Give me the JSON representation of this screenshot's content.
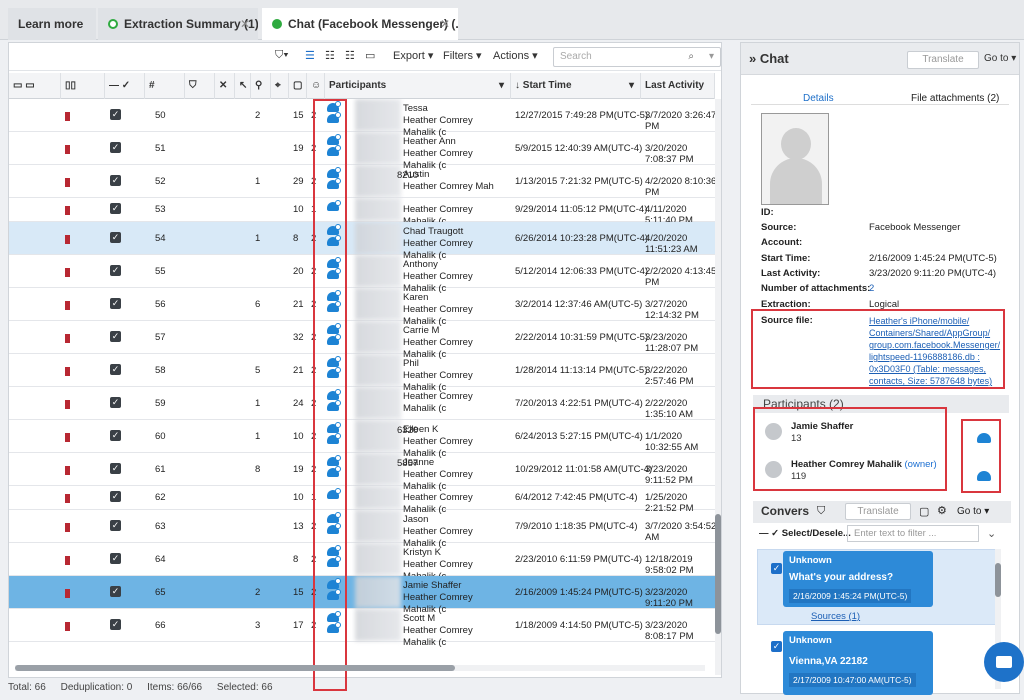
{
  "tabs": [
    {
      "label": "Learn more",
      "active": false,
      "has_dot": false,
      "closable": false
    },
    {
      "label": "Extraction Summary (1)",
      "active": false,
      "has_dot": true,
      "dot_color": "#2eaa3f",
      "closable": true
    },
    {
      "label": "Chat (Facebook Messenger) (...",
      "active": true,
      "has_dot": true,
      "dot_color": "#2eaa3f",
      "closable": true
    }
  ],
  "toolbar": {
    "export": "Export",
    "filters": "Filters",
    "actions": "Actions",
    "search_placeholder": "Search"
  },
  "columns": {
    "num": "#",
    "participants": "Participants",
    "start": "Start Time",
    "last": "Last Activity"
  },
  "rows": [
    {
      "num": "50",
      "att": "2",
      "c1": "15",
      "c2": "2",
      "p1": "Tessa ",
      "p2": "Heather Comrey Mahalik (c",
      "st": "12/27/2015 7:49:28 PM(UTC-5)",
      "la": "3/7/2020 3:26:47 PM",
      "pid": "",
      "sel": ""
    },
    {
      "num": "51",
      "att": "",
      "c1": "19",
      "c2": "2",
      "p1": "Heather Ann",
      "p2": "Heather Comrey Mahalik (c",
      "st": "5/9/2015 12:40:39 AM(UTC-4)",
      "la": "3/20/2020 7:08:37 PM",
      "pid": "",
      "sel": ""
    },
    {
      "num": "52",
      "att": "1",
      "c1": "29",
      "c2": "2",
      "p1": "Austin ",
      "p2": "Heather Comrey Mah",
      "st": "1/13/2015 7:21:32 PM(UTC-5)",
      "la": "4/2/2020 8:10:36 PM",
      "pid": "8210",
      "sel": ""
    },
    {
      "num": "53",
      "att": "",
      "c1": "10",
      "c2": "1",
      "p1": "",
      "p2": "Heather Comrey Mahalik (c",
      "st": "9/29/2014 11:05:12 PM(UTC-4)",
      "la": "4/11/2020 5:11:40 PM",
      "pid": "",
      "sel": ""
    },
    {
      "num": "54",
      "att": "1",
      "c1": "8",
      "c2": "2",
      "p1": "Chad Traugott",
      "p2": "Heather Comrey Mahalik (c",
      "st": "6/26/2014 10:23:28 PM(UTC-4)",
      "la": "4/20/2020 11:51:23 AM",
      "pid": "",
      "sel": "light"
    },
    {
      "num": "55",
      "att": "",
      "c1": "20",
      "c2": "2",
      "p1": "Anthony ",
      "p2": "Heather Comrey Mahalik (c",
      "st": "5/12/2014 12:06:33 PM(UTC-4)",
      "la": "2/2/2020 4:13:45 PM",
      "pid": "",
      "sel": ""
    },
    {
      "num": "56",
      "att": "6",
      "c1": "21",
      "c2": "2",
      "p1": "Karen ",
      "p2": "Heather Comrey Mahalik (c",
      "st": "3/2/2014 12:37:46 AM(UTC-5)",
      "la": "3/27/2020 12:14:32 PM",
      "pid": "",
      "sel": ""
    },
    {
      "num": "57",
      "att": "",
      "c1": "32",
      "c2": "2",
      "p1": "Carrie M",
      "p2": "Heather Comrey Mahalik (c",
      "st": "2/22/2014 10:31:59 PM(UTC-5)",
      "la": "3/23/2020 11:28:07 PM",
      "pid": "",
      "sel": ""
    },
    {
      "num": "58",
      "att": "5",
      "c1": "21",
      "c2": "2",
      "p1": "Phil ",
      "p2": "Heather Comrey Mahalik (c",
      "st": "1/28/2014 11:13:14 PM(UTC-5)",
      "la": "3/22/2020 2:57:46 PM",
      "pid": "",
      "sel": ""
    },
    {
      "num": "59",
      "att": "1",
      "c1": "24",
      "c2": "2",
      "p1": "",
      "p2": "Heather Comrey Mahalik (c",
      "st": "7/20/2013 4:22:51 PM(UTC-4)",
      "la": "2/22/2020 1:35:10 AM",
      "pid": "",
      "sel": ""
    },
    {
      "num": "60",
      "att": "1",
      "c1": "10",
      "c2": "2",
      "p1": "Eileen K",
      "p2": "Heather Comrey Mahalik (c",
      "st": "6/24/2013 5:27:15 PM(UTC-4)",
      "la": "1/1/2020 10:32:55 AM",
      "pid": "6320",
      "sel": ""
    },
    {
      "num": "61",
      "att": "8",
      "c1": "19",
      "c2": "2",
      "p1": "Joanne ",
      "p2": "Heather Comrey Mahalik (c",
      "st": "10/29/2012 11:01:58 AM(UTC-4)",
      "la": "3/23/2020 9:11:52 PM",
      "pid": "5857",
      "sel": ""
    },
    {
      "num": "62",
      "att": "",
      "c1": "10",
      "c2": "1",
      "p1": "",
      "p2": "Heather Comrey Mahalik (c",
      "st": "6/4/2012 7:42:45 PM(UTC-4)",
      "la": "1/25/2020 2:21:52 PM",
      "pid": "",
      "sel": ""
    },
    {
      "num": "63",
      "att": "",
      "c1": "13",
      "c2": "2",
      "p1": "Jason ",
      "p2": "Heather Comrey Mahalik (c",
      "st": "7/9/2010 1:18:35 PM(UTC-4)",
      "la": "3/7/2020 3:54:52 AM",
      "pid": "",
      "sel": ""
    },
    {
      "num": "64",
      "att": "",
      "c1": "8",
      "c2": "2",
      "p1": "Kristyn K",
      "p2": "Heather Comrey Mahalik (c",
      "st": "2/23/2010 6:11:59 PM(UTC-4)",
      "la": "12/18/2019 9:58:02 PM",
      "pid": "",
      "sel": ""
    },
    {
      "num": "65",
      "att": "2",
      "c1": "15",
      "c2": "2",
      "p1": "Jamie Shaffer",
      "p2": "Heather Comrey Mahalik (c",
      "st": "2/16/2009 1:45:24 PM(UTC-5)",
      "la": "3/23/2020 9:11:20 PM",
      "pid": "",
      "sel": "dark"
    },
    {
      "num": "66",
      "att": "3",
      "c1": "17",
      "c2": "2",
      "p1": "Scott M",
      "p2": "Heather Comrey Mahalik (c",
      "st": "1/18/2009 4:14:50 PM(UTC-5)",
      "la": "3/23/2020 8:08:17 PM",
      "pid": "",
      "sel": ""
    }
  ],
  "status": {
    "total": "Total: 66",
    "dedup": "Deduplication: 0",
    "items": "Items: 66/66",
    "selected": "Selected: 66"
  },
  "right": {
    "title": "Chat",
    "translate": "Translate",
    "goto": "Go to",
    "tab_details": "Details",
    "tab_files": "File attachments (2)",
    "details": [
      {
        "label": "ID:",
        "value": ""
      },
      {
        "label": "Source:",
        "value": "Facebook Messenger"
      },
      {
        "label": "Account:",
        "value": ""
      },
      {
        "label": "Start Time:",
        "value": "2/16/2009 1:45:24 PM(UTC-5)"
      },
      {
        "label": "Last Activity:",
        "value": "3/23/2020 9:11:20 PM(UTC-4)"
      },
      {
        "label": "Number of attachments:",
        "value": "2"
      },
      {
        "label": "Extraction:",
        "value": "Logical"
      }
    ],
    "source_file_label": "Source file:",
    "source_file_lines": [
      "Heather's iPhone/mobile/",
      "Containers/Shared/AppGroup/",
      "group.com.facebook.Messenger/",
      "lightspeed-1196888186.db :",
      "0x3D03F0 (Table: messages,",
      "contacts, Size: 5787648 bytes)"
    ],
    "participants_title": "Participants (2)",
    "participants": [
      {
        "name": "Jamie Shaffer",
        "id": "13",
        "owner": ""
      },
      {
        "name": "Heather Comrey Mahalik",
        "id": "119",
        "owner": "(owner)"
      }
    ],
    "conv_title": "Convers",
    "conv_translate": "Translate",
    "conv_goto": "Go to",
    "select_label": "Select/Desele...",
    "filter_placeholder": "Enter text to filter ...",
    "messages": [
      {
        "sender": "Unknown",
        "text": "What's your address?",
        "time": "2/16/2009 1:45:24 PM(UTC-5)",
        "sources": "Sources (1)"
      },
      {
        "sender": "Unknown",
        "text": "Vienna,VA 22182",
        "time": "2/17/2009 10:47:00 AM(UTC-5)"
      }
    ]
  }
}
